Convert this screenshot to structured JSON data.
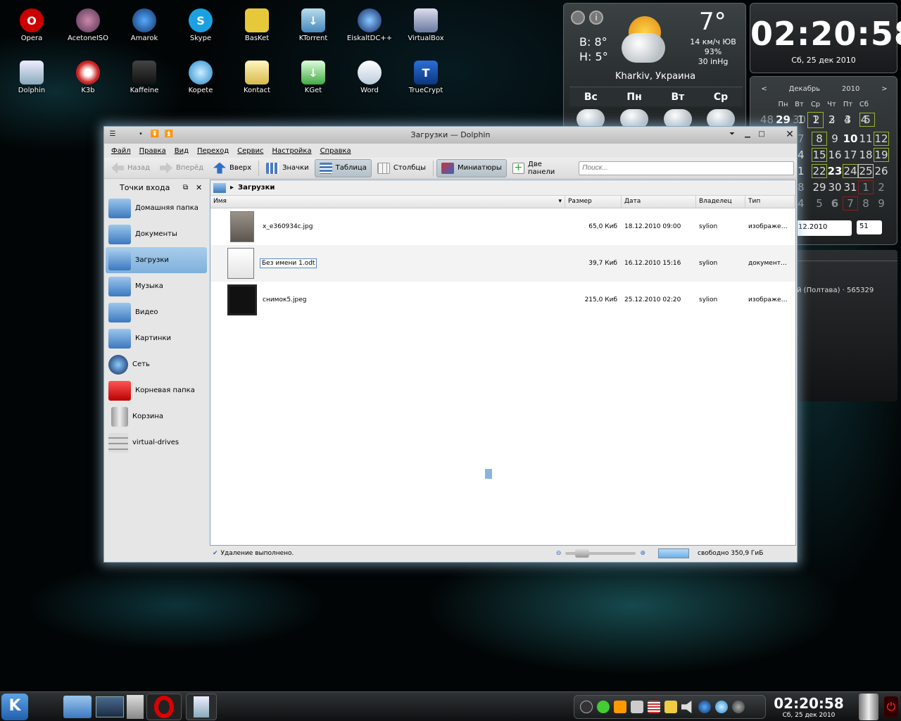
{
  "desktop": {
    "row1": [
      "Opera",
      "AcetoneISO",
      "Amarok",
      "Skype",
      "BasKet",
      "KTorrent",
      "EiskaltDC++",
      "VirtualBox"
    ],
    "row2": [
      "Dolphin",
      "K3b",
      "Kaffeine",
      "Kopete",
      "Kontact",
      "KGet",
      "Word",
      "TrueCrypt"
    ]
  },
  "weather": {
    "high": "В: 8°",
    "low": "Н: 5°",
    "temp": "7°",
    "wind": "14 км/ч ЮВ",
    "humidity": "93%",
    "pressure": "30 inHg",
    "city": "Kharkiv, Украина",
    "days": [
      "Вс",
      "Пн",
      "Вт",
      "Ср"
    ]
  },
  "clock": {
    "time": "02:20:58",
    "date": "Сб, 25 дек 2010"
  },
  "calendar": {
    "prev": "<",
    "month": "Декабрь",
    "year": "2010",
    "next": ">",
    "daynames": [
      "Пн",
      "Вт",
      "Ср",
      "Чт",
      "Пт",
      "Сб",
      "Вс"
    ],
    "weeks": [
      [
        "48",
        "29",
        "30",
        "1",
        "2",
        "3",
        "4",
        "5"
      ],
      [
        "7",
        "8",
        "9",
        "10",
        "11",
        "12"
      ],
      [
        "4",
        "15",
        "16",
        "17",
        "18",
        "19"
      ],
      [
        "1",
        "22",
        "23",
        "24",
        "25",
        "26"
      ],
      [
        "8",
        "29",
        "30",
        "31",
        "1",
        "2"
      ],
      [
        "4",
        "5",
        "6",
        "7",
        "8",
        "9"
      ]
    ],
    "date_field": "12.2010",
    "week_spin": "51"
  },
  "notes": {
    "text": "й (Полтава) · 565329"
  },
  "window": {
    "title": "Загрузки — Dolphin",
    "menu": [
      "Файл",
      "Правка",
      "Вид",
      "Переход",
      "Сервис",
      "Настройка",
      "Справка"
    ],
    "toolbar": {
      "back": "Назад",
      "forward": "Вперёд",
      "up": "Вверх",
      "icons": "Значки",
      "table": "Таблица",
      "columns": "Столбцы",
      "thumbs": "Миниатюры",
      "split": "Две панели",
      "search_placeholder": "Поиск..."
    },
    "places_title": "Точки входа",
    "places": [
      "Домашняя папка",
      "Документы",
      "Загрузки",
      "Музыка",
      "Видео",
      "Картинки",
      "Сеть",
      "Корневая папка",
      "Корзина",
      "virtual-drives"
    ],
    "breadcrumb": "Загрузки",
    "columns": [
      "Имя",
      "Размер",
      "Дата",
      "Владелец",
      "Тип"
    ],
    "files": [
      {
        "name": "x_e360934c.jpg",
        "size": "65,0 Киб",
        "date": "18.12.2010 09:00",
        "owner": "sylion",
        "type": "изображе…"
      },
      {
        "name": "Без имени 1.odt",
        "size": "39,7 Киб",
        "date": "16.12.2010 15:16",
        "owner": "sylion",
        "type": "документ…"
      },
      {
        "name": "снимок5.jpeg",
        "size": "215,0 Киб",
        "date": "25.12.2010 02:20",
        "owner": "sylion",
        "type": "изображе…"
      }
    ],
    "status": "Удаление выполнено.",
    "free": "свободно 350,9 ГиБ"
  },
  "panel": {
    "time": "02:20:58",
    "date": "Сб, 25 дек 2010"
  }
}
